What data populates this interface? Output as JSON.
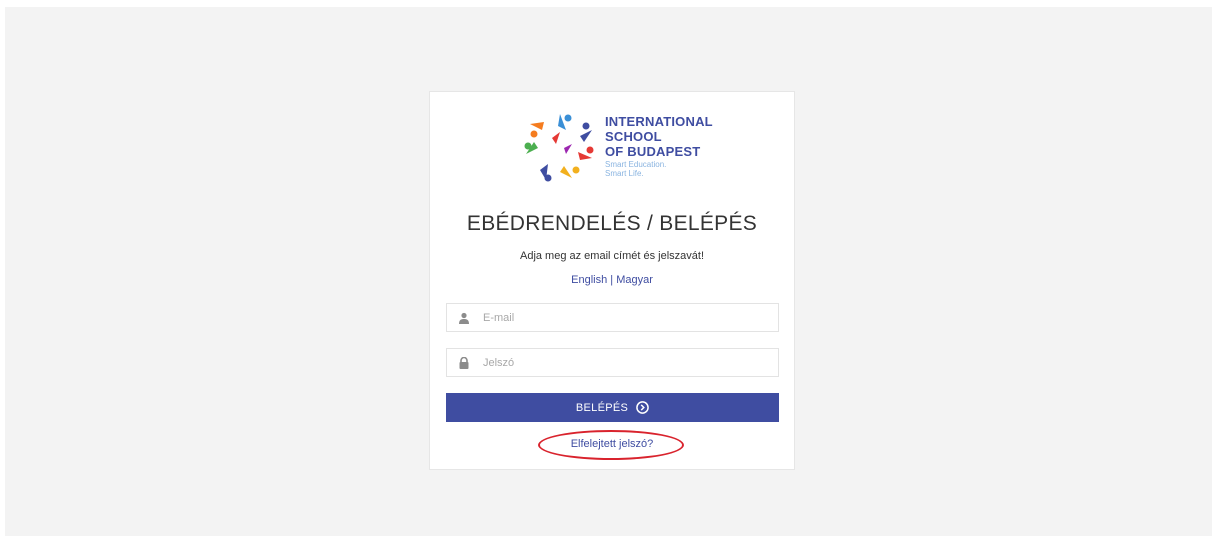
{
  "logo": {
    "line1": "INTERNATIONAL",
    "line2": "SCHOOL",
    "line3": "OF BUDAPEST",
    "tagline1": "Smart Education.",
    "tagline2": "Smart Life."
  },
  "title": "EBÉDRENDELÉS / BELÉPÉS",
  "subtitle": "Adja meg az email címét és jelszavát!",
  "lang": {
    "english": "English",
    "separator": " | ",
    "hungarian": "Magyar"
  },
  "email": {
    "placeholder": "E-mail",
    "value": "",
    "icon": "user-icon"
  },
  "password": {
    "placeholder": "Jelszó",
    "value": "",
    "icon": "lock-icon"
  },
  "login_button": {
    "label": "BELÉPÉS",
    "icon": "circle-arrow-right-icon"
  },
  "forgot_link": "Elfelejtett jelszó?",
  "colors": {
    "brand": "#3f4da1",
    "highlight": "#d9232d",
    "background": "#f3f3f3"
  }
}
